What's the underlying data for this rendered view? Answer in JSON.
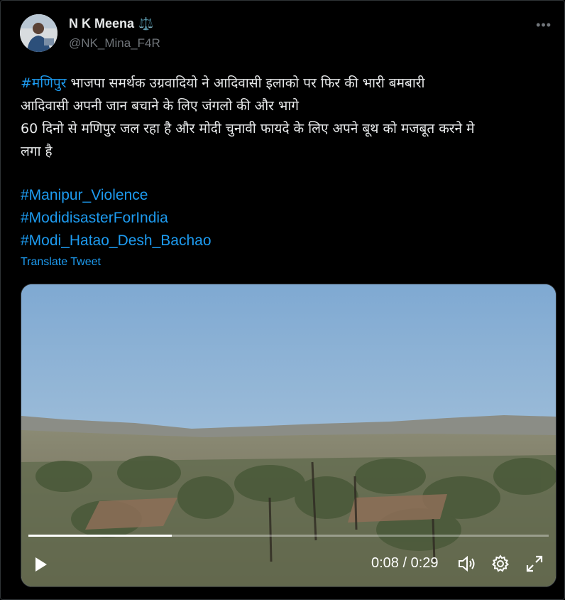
{
  "author": {
    "name": "N K Meena",
    "badge": "⚖️",
    "handle": "@NK_Mina_F4R"
  },
  "more_icon": "more-horizontal-icon",
  "tweet": {
    "hashtag_manipur": "#मणिपुर",
    "line1_rest": " भाजपा समर्थक उग्रवादियो ने आदिवासी इलाको पर फिर की भारी बमबारी",
    "line2": "आदिवासी अपनी जान बचाने के लिए जंगलो की और भागे",
    "line3": "60 दिनो से मणिपुर जल रहा है और मोदी चुनावी फायदे के लिए अपने बूथ को मजबूत करने मे",
    "line4": "लगा है",
    "hashtags": [
      "#Manipur_Violence",
      "#ModidisasterForIndia",
      "#Modi_Hatao_Desh_Bachao"
    ]
  },
  "translate_label": "Translate Tweet",
  "video": {
    "current_time": "0:08",
    "separator": " / ",
    "duration": "0:29",
    "progress": 0.276
  },
  "colors": {
    "accent": "#1d9bf0",
    "background": "#000000",
    "text": "#e7e9ea",
    "secondary": "#71767b"
  }
}
